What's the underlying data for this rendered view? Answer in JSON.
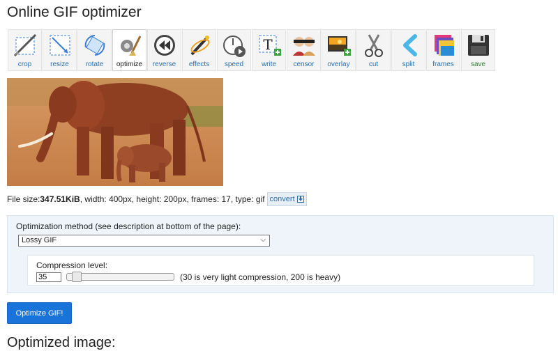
{
  "page": {
    "title": "Online GIF optimizer"
  },
  "toolbar": {
    "tools": [
      {
        "label": "crop"
      },
      {
        "label": "resize"
      },
      {
        "label": "rotate"
      },
      {
        "label": "optimize"
      },
      {
        "label": "reverse"
      },
      {
        "label": "effects"
      },
      {
        "label": "speed"
      },
      {
        "label": "write"
      },
      {
        "label": "censor"
      },
      {
        "label": "overlay"
      },
      {
        "label": "cut"
      },
      {
        "label": "split"
      },
      {
        "label": "frames"
      },
      {
        "label": "save"
      }
    ],
    "active": "optimize"
  },
  "file_info": {
    "prefix": "File size: ",
    "size": "347.51KiB",
    "details": ", width: 400px, height: 200px, frames: 17, type: gif",
    "convert_label": "convert"
  },
  "optimization": {
    "method_label": "Optimization method (see description at bottom of the page):",
    "method_selected": "Lossy GIF",
    "compression_label": "Compression level:",
    "compression_value": "35",
    "compression_hint": "(30 is very light compression, 200 is heavy)",
    "slider_fraction": 0.05
  },
  "actions": {
    "optimize_label": "Optimize GIF!"
  },
  "result": {
    "heading": "Optimized image:"
  },
  "colors": {
    "accent": "#1a73d9",
    "link": "#2a6fb0",
    "save": "#2e7d32",
    "panel": "#eef4f9"
  }
}
